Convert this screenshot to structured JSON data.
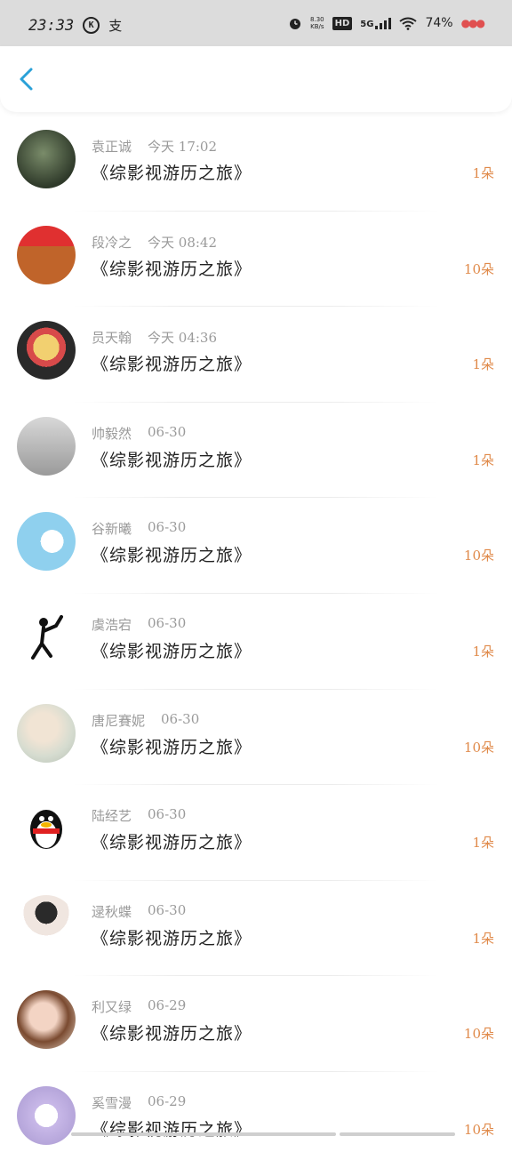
{
  "status_bar": {
    "time": "23:33",
    "speed": "8.30\nKB/s",
    "hd": "HD",
    "network": "5G",
    "battery": "74%"
  },
  "colors": {
    "accent": "#2aa1d8",
    "count": "#e08a4a"
  },
  "items": [
    {
      "name": "袁正诚",
      "time": "今天 17:02",
      "title": "《综影视游历之旅》",
      "count": "1朵"
    },
    {
      "name": "段冷之",
      "time": "今天 08:42",
      "title": "《综影视游历之旅》",
      "count": "10朵"
    },
    {
      "name": "员天翰",
      "time": "今天 04:36",
      "title": "《综影视游历之旅》",
      "count": "1朵"
    },
    {
      "name": "帅毅然",
      "time": "06-30",
      "title": "《综影视游历之旅》",
      "count": "1朵"
    },
    {
      "name": "谷新曦",
      "time": "06-30",
      "title": "《综影视游历之旅》",
      "count": "10朵"
    },
    {
      "name": "虞浩宕",
      "time": "06-30",
      "title": "《综影视游历之旅》",
      "count": "1朵"
    },
    {
      "name": "唐尼賽妮",
      "time": "06-30",
      "title": "《综影视游历之旅》",
      "count": "10朵"
    },
    {
      "name": "陆经艺",
      "time": "06-30",
      "title": "《综影视游历之旅》",
      "count": "1朵"
    },
    {
      "name": "逯秋蝶",
      "time": "06-30",
      "title": "《综影视游历之旅》",
      "count": "1朵"
    },
    {
      "name": "利又绿",
      "time": "06-29",
      "title": "《综影视游历之旅》",
      "count": "10朵"
    },
    {
      "name": "奚雪漫",
      "time": "06-29",
      "title": "《综影视游历之旅》",
      "count": "10朵"
    }
  ]
}
